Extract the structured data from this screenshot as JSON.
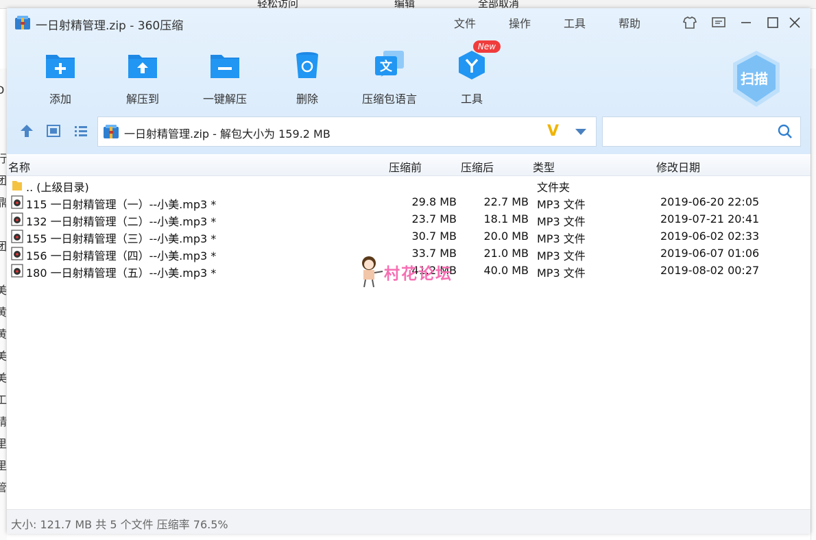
{
  "background": {
    "top_fragments": [
      "轻松访问",
      "全部取消",
      "编辑"
    ],
    "left_fragments": [
      "D",
      "行",
      "团",
      "鼎",
      "团",
      "美",
      "黄",
      "黄",
      "美",
      "美",
      "工",
      "精",
      "里",
      "里",
      "管"
    ]
  },
  "window": {
    "title": "一日射精管理.zip - 360压缩",
    "menus": [
      "文件",
      "操作",
      "工具",
      "帮助"
    ],
    "controls": {
      "skin": "skin-icon",
      "feedback": "feedback-icon",
      "minimize": "minimize-icon",
      "maximize": "maximize-icon",
      "close": "close-icon"
    }
  },
  "toolbar": {
    "items": [
      {
        "label": "添加",
        "icon": "add-folder-icon"
      },
      {
        "label": "解压到",
        "icon": "extract-to-icon"
      },
      {
        "label": "一键解压",
        "icon": "one-click-extract-icon"
      },
      {
        "label": "删除",
        "icon": "delete-icon"
      },
      {
        "label": "压缩包语言",
        "icon": "language-icon"
      },
      {
        "label": "工具",
        "icon": "tools-icon"
      }
    ],
    "new_badge": "New",
    "scan_label": "扫描"
  },
  "address": {
    "text": "一日射精管理.zip - 解包大小为 159.2 MB",
    "v_mark": "V",
    "search_placeholder": ""
  },
  "columns": {
    "name": "名称",
    "before": "压缩前",
    "after": "压缩后",
    "type": "类型",
    "date": "修改日期"
  },
  "parent_row": {
    "name": ".. (上级目录)",
    "type": "文件夹"
  },
  "files": [
    {
      "name": "115 一日射精管理（一）--小美.mp3 *",
      "before": "29.8 MB",
      "after": "22.7 MB",
      "type": "MP3 文件",
      "date": "2019-06-20 22:05"
    },
    {
      "name": "132 一日射精管理（二）--小美.mp3 *",
      "before": "23.7 MB",
      "after": "18.1 MB",
      "type": "MP3 文件",
      "date": "2019-07-21 20:41"
    },
    {
      "name": "155 一日射精管理（三）--小美.mp3 *",
      "before": "30.7 MB",
      "after": "20.0 MB",
      "type": "MP3 文件",
      "date": "2019-06-02 02:33"
    },
    {
      "name": "156 一日射精管理（四）--小美.mp3 *",
      "before": "33.7 MB",
      "after": "21.0 MB",
      "type": "MP3 文件",
      "date": "2019-06-07 01:06"
    },
    {
      "name": "180 一日射精管理（五）--小美.mp3 *",
      "before": "41.2 MB",
      "after": "40.0 MB",
      "type": "MP3 文件",
      "date": "2019-08-02 00:27"
    }
  ],
  "watermark": "村花论坛",
  "status": "大小: 121.7 MB 共 5 个文件 压缩率 76.5%",
  "colors": {
    "accent": "#1e88e5",
    "header_bg": "#dceefc",
    "badge": "#f03c3c",
    "watermark": "#f66fb3"
  }
}
